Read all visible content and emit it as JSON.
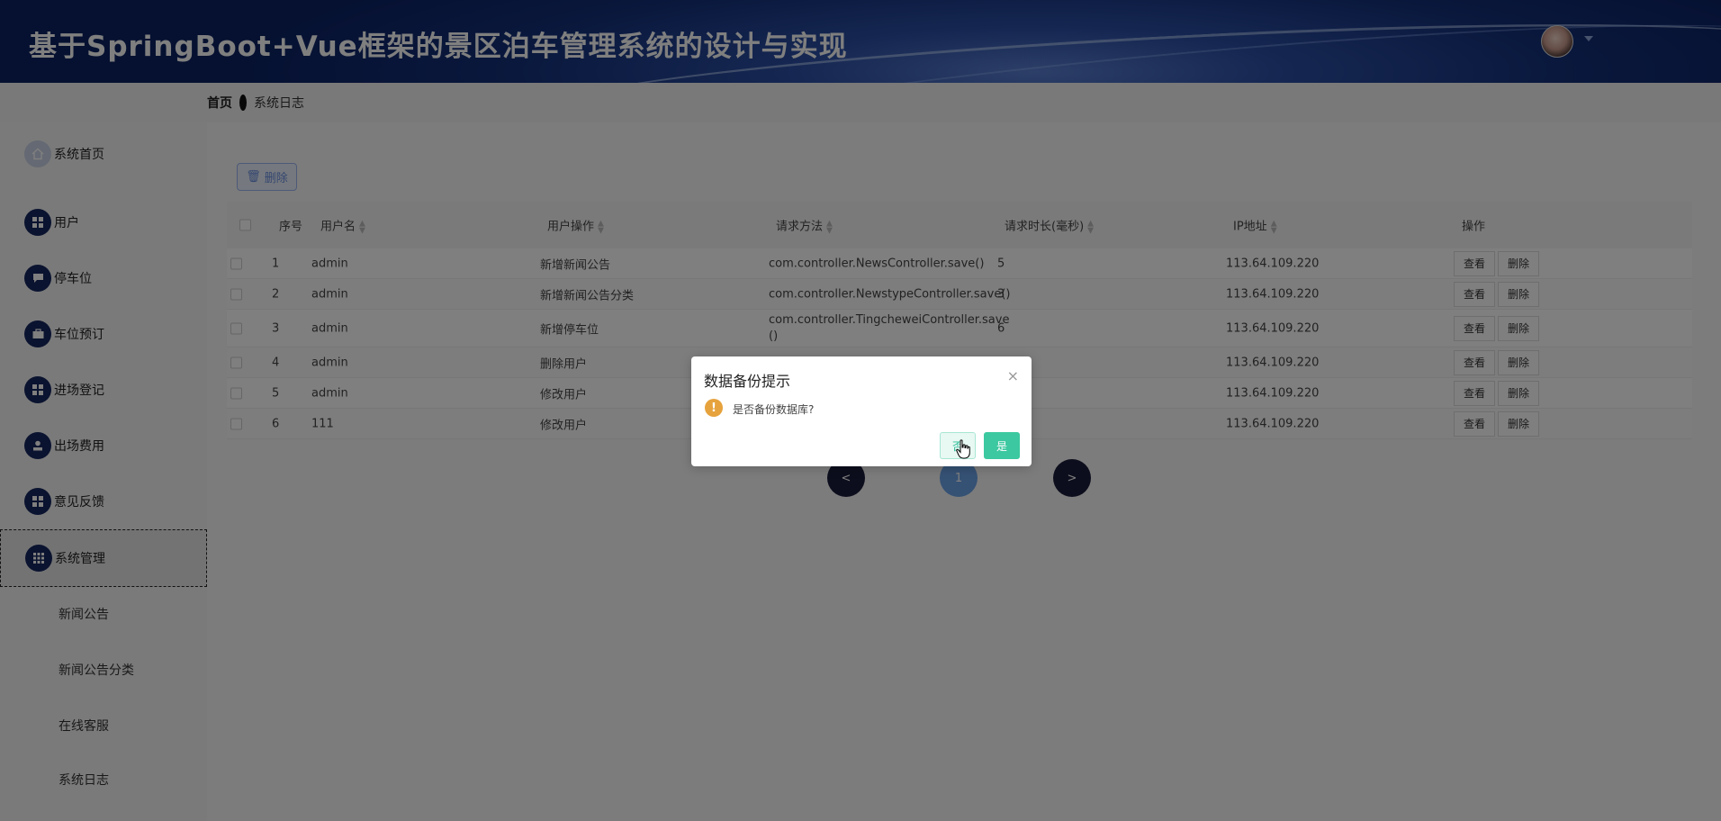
{
  "header": {
    "title": "基于SpringBoot+Vue框架的景区泊车管理系统的设计与实现"
  },
  "breadcrumb": {
    "home": "首页",
    "current": "系统日志"
  },
  "sidebar": {
    "items": [
      {
        "label": "系统首页",
        "icon": "home-icon"
      },
      {
        "label": "用户",
        "icon": "grid-icon"
      },
      {
        "label": "停车位",
        "icon": "chat-icon"
      },
      {
        "label": "车位预订",
        "icon": "briefcase-icon"
      },
      {
        "label": "进场登记",
        "icon": "grid-icon"
      },
      {
        "label": "出场费用",
        "icon": "person-icon"
      },
      {
        "label": "意见反馈",
        "icon": "grid-icon"
      },
      {
        "label": "系统管理",
        "icon": "apps-icon"
      }
    ],
    "subitems": [
      {
        "label": "新闻公告"
      },
      {
        "label": "新闻公告分类"
      },
      {
        "label": "在线客服"
      },
      {
        "label": "系统日志"
      }
    ]
  },
  "toolbar": {
    "delete_label": "删除"
  },
  "table": {
    "headers": {
      "index": "序号",
      "username": "用户名",
      "operation": "用户操作",
      "method": "请求方法",
      "duration": "请求时长(毫秒)",
      "ip": "IP地址",
      "actions": "操作"
    },
    "view_label": "查看",
    "delete_label": "删除",
    "rows": [
      {
        "index": "1",
        "username": "admin",
        "operation": "新增新闻公告",
        "method": "com.controller.NewsController.save()",
        "method2": "",
        "duration": "5",
        "ip": "113.64.109.220"
      },
      {
        "index": "2",
        "username": "admin",
        "operation": "新增新闻公告分类",
        "method": "com.controller.NewstypeController.save()",
        "method2": "",
        "duration": "3",
        "ip": "113.64.109.220"
      },
      {
        "index": "3",
        "username": "admin",
        "operation": "新增停车位",
        "method": "com.controller.TingcheweiController.save",
        "method2": "()",
        "duration": "6",
        "ip": "113.64.109.220"
      },
      {
        "index": "4",
        "username": "admin",
        "operation": "删除用户",
        "method": "",
        "method2": "",
        "duration": "",
        "ip": "113.64.109.220"
      },
      {
        "index": "5",
        "username": "admin",
        "operation": "修改用户",
        "method": "",
        "method2": "",
        "duration": "",
        "ip": "113.64.109.220"
      },
      {
        "index": "6",
        "username": "111",
        "operation": "修改用户",
        "method": "",
        "method2": "",
        "duration": "",
        "ip": "113.64.109.220"
      }
    ]
  },
  "pagination": {
    "prev": "<",
    "current": "1",
    "next": ">"
  },
  "dialog": {
    "title": "数据备份提示",
    "message": "是否备份数据库?",
    "no_label": "否",
    "yes_label": "是",
    "close_label": "×"
  },
  "colors": {
    "header_bg": "#14307a",
    "accent": "#3cc8a0",
    "sidebar_icon": "#15265f",
    "warning": "#e6a23c"
  }
}
